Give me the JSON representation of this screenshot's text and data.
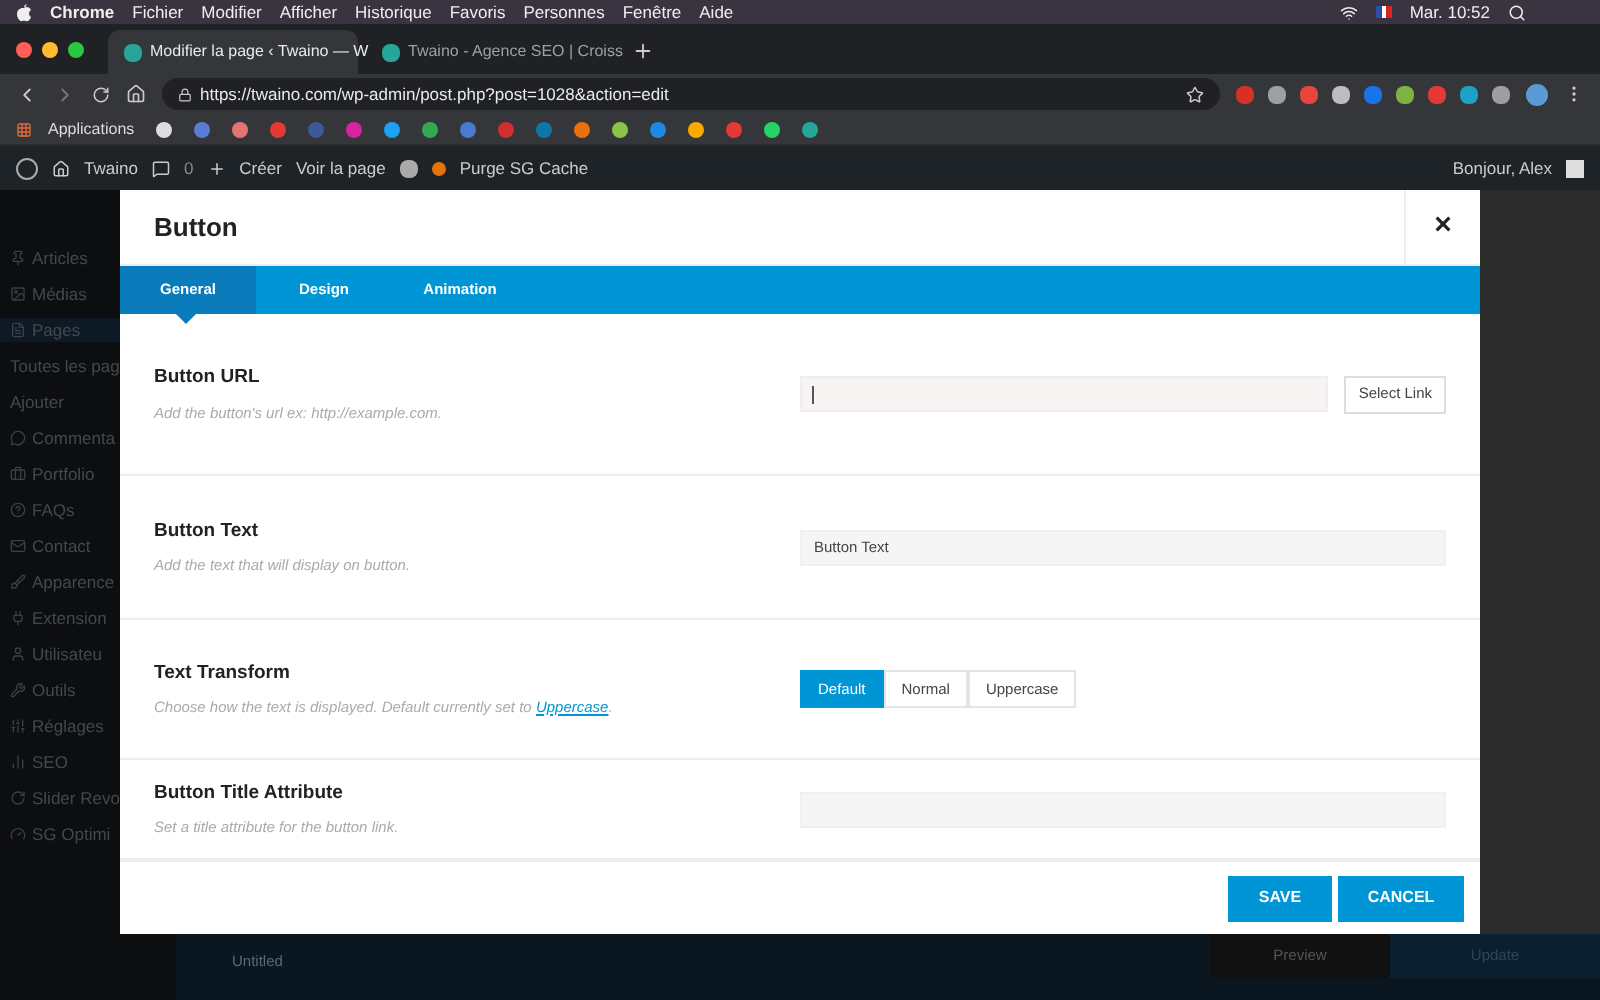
{
  "menubar": {
    "app": "Chrome",
    "items": [
      "Fichier",
      "Modifier",
      "Afficher",
      "Historique",
      "Favoris",
      "Personnes",
      "Fenêtre",
      "Aide"
    ],
    "clock": "Mar. 10:52"
  },
  "tabs": [
    {
      "title": "Modifier la page ‹ Twaino — W",
      "selected": true
    },
    {
      "title": "Twaino - Agence SEO | Croiss",
      "selected": false
    }
  ],
  "address": "https://twaino.com/wp-admin/post.php?post=1028&action=edit",
  "extensions": [
    {
      "color": "#d93025"
    },
    {
      "color": "#9aa0a6"
    },
    {
      "color": "#e8453c"
    },
    {
      "color": "#bdbdbd"
    },
    {
      "color": "#1a73e8"
    },
    {
      "color": "#7cb342"
    },
    {
      "color": "#e53935"
    },
    {
      "color": "#1da1c4"
    },
    {
      "color": "#9e9e9e"
    }
  ],
  "bookmarks": {
    "apps_label": "Applications",
    "icons": [
      {
        "color": "#dddddd"
      },
      {
        "color": "#5b7bd5"
      },
      {
        "color": "#e57373"
      },
      {
        "color": "#e53935"
      },
      {
        "color": "#3b5998"
      },
      {
        "color": "#d6249f"
      },
      {
        "color": "#1da1f2"
      },
      {
        "color": "#34a853"
      },
      {
        "color": "#4a7bd0"
      },
      {
        "color": "#d32f2f"
      },
      {
        "color": "#0e76a8"
      },
      {
        "color": "#e8710a"
      },
      {
        "color": "#8bc34a"
      },
      {
        "color": "#1e88e5"
      },
      {
        "color": "#f9ab00"
      },
      {
        "color": "#e53935"
      },
      {
        "color": "#25d366"
      },
      {
        "color": "#26a69a"
      }
    ]
  },
  "admin_bar": {
    "site": "Twaino",
    "comments": "0",
    "new": "Créer",
    "view": "Voir la page",
    "purge": "Purge SG Cache",
    "greeting": "Bonjour, Alex"
  },
  "sidebar": [
    "Articles",
    "Médias",
    "Pages",
    "Toutes les pag",
    "Ajouter",
    "Commenta",
    "Portfolio",
    "FAQs",
    "Contact",
    "Apparence",
    "Extension",
    "Utilisateu",
    "Outils",
    "Réglages",
    "SEO",
    "Slider Revo",
    "SG Optimi"
  ],
  "modal": {
    "title": "Button",
    "close": "×",
    "tabs": [
      {
        "label": "General",
        "selected": true
      },
      {
        "label": "Design",
        "selected": false
      },
      {
        "label": "Animation",
        "selected": false
      }
    ],
    "fields": [
      {
        "kind": "link",
        "label": "Button URL",
        "description": "Add the button's url ex: http://example.com.",
        "button": "Select Link"
      },
      {
        "kind": "text",
        "label": "Button Text",
        "description": "Add the text that will display on button.",
        "value": "Button Text"
      },
      {
        "kind": "choice",
        "label": "Text Transform",
        "description": "Choose how the text is displayed. Default currently set to",
        "link": "Uppercase",
        "link_end": ".",
        "options": [
          {
            "label": "Default",
            "selected": true
          },
          {
            "label": "Normal",
            "selected": false
          },
          {
            "label": "Uppercase",
            "selected": false
          }
        ]
      },
      {
        "kind": "text",
        "label": "Button Title Attribute",
        "description": "Set a title attribute for the button link."
      }
    ],
    "buttons": [
      "SAVE",
      "CANCEL"
    ]
  },
  "bottom": {
    "title": "Untitled",
    "preview": "Preview",
    "update": "Update"
  }
}
